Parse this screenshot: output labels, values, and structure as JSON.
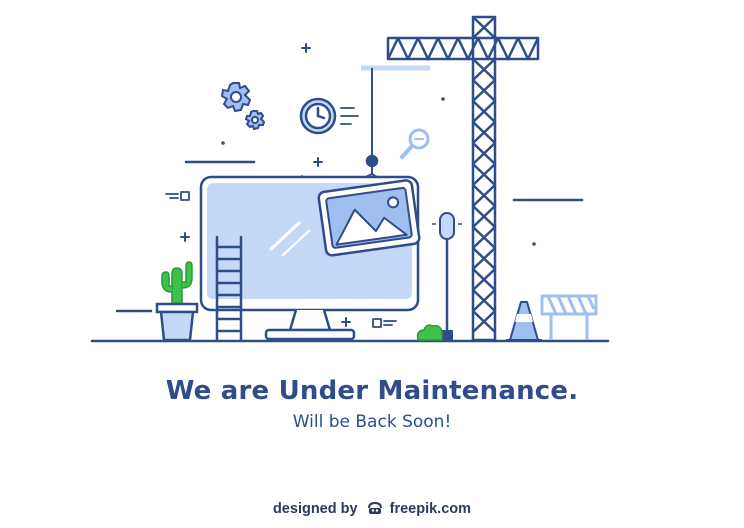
{
  "message": {
    "title": "We are Under Maintenance.",
    "subtitle": "Will be Back Soon!"
  },
  "credit": {
    "prefix": "designed by",
    "brand": "freepik.com",
    "icon": "freepik-logo-icon"
  },
  "illustration": {
    "icons": [
      "gear-icon",
      "clock-icon",
      "magnifier-icon",
      "monitor-icon",
      "image-frame-icon",
      "ladder-icon",
      "cactus-icon",
      "crane-icon",
      "lamp-icon",
      "traffic-cone-icon",
      "barrier-icon",
      "bush-icon"
    ],
    "colors": {
      "outline": "#2e4d8a",
      "fill_light": "#c6d8f7",
      "fill_mid": "#9fbff0",
      "plant_green": "#3ec14b",
      "text": "#2e4d8a"
    }
  }
}
